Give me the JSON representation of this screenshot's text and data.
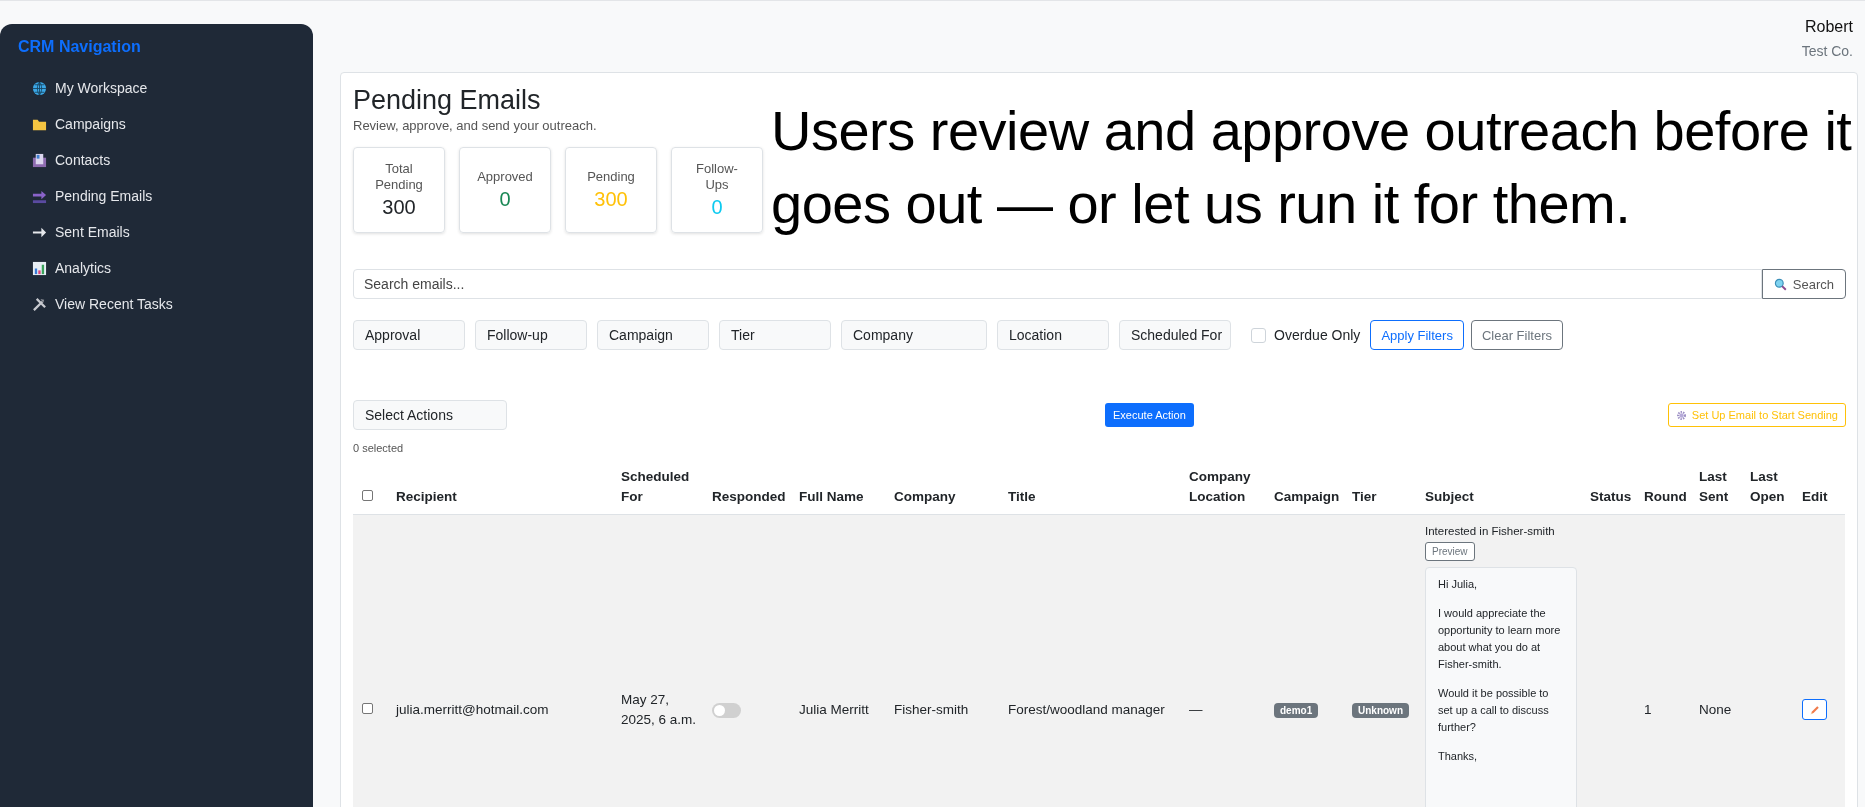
{
  "sidebar": {
    "title": "CRM Navigation",
    "items": [
      {
        "label": "My Workspace",
        "kind": "globe"
      },
      {
        "label": "Campaigns",
        "kind": "folder"
      },
      {
        "label": "Contacts",
        "kind": "contacts"
      },
      {
        "label": "Pending Emails",
        "kind": "soon"
      },
      {
        "label": "Sent Emails",
        "kind": "arrow"
      },
      {
        "label": "Analytics",
        "kind": "chart"
      },
      {
        "label": "View Recent Tasks",
        "kind": "tools"
      }
    ]
  },
  "user": {
    "name": "Robert",
    "company": "Test Co."
  },
  "page": {
    "title": "Pending Emails",
    "subtitle": "Review, approve, and send your outreach."
  },
  "stats": [
    {
      "label": "Total Pending",
      "value": "300",
      "color": "#212529"
    },
    {
      "label": "Approved",
      "value": "0",
      "color": "#198754"
    },
    {
      "label": "Pending",
      "value": "300",
      "color": "#ffc107"
    },
    {
      "label": "Follow-Ups",
      "value": "0",
      "color": "#0dcaf0"
    }
  ],
  "annotation": "Users review and approve outreach before it goes out — or let us run it for them.",
  "search": {
    "placeholder": "Search emails...",
    "button": "Search"
  },
  "filters": [
    "Approval",
    "Follow-up",
    "Campaign",
    "Tier",
    "Company",
    "Location",
    "Scheduled For"
  ],
  "overdue_only": {
    "label": "Overdue Only",
    "checked": false
  },
  "filter_buttons": [
    {
      "label": "Apply Filters",
      "kind": "primary"
    },
    {
      "label": "Clear Filters",
      "kind": "secondary"
    }
  ],
  "actions": {
    "select": "Select Actions",
    "execute": "Execute Action",
    "setup": "Set Up Email to Start Sending",
    "selected_count": "0 selected"
  },
  "table": {
    "select_all_checked": false,
    "columns": [
      "Recipient",
      "Scheduled For",
      "Responded",
      "Full Name",
      "Company",
      "Title",
      "Company Location",
      "Campaign",
      "Tier",
      "Subject",
      "Status",
      "Round",
      "Last Sent",
      "Last Open",
      "Edit"
    ],
    "rows": [
      {
        "checked": false,
        "recipient": "julia.merritt@hotmail.com",
        "scheduled_for": "May 27, 2025, 6 a.m.",
        "responded": false,
        "full_name": "Julia Merritt",
        "company": "Fisher-smith",
        "title": "Forest/woodland manager",
        "company_location": "—",
        "campaign": "demo1",
        "tier": "Unknown",
        "subject": "Interested in Fisher-smith",
        "preview_button": "Preview",
        "body": [
          "Hi Julia,",
          "I would appreciate the opportunity to learn more about what you do at Fisher-smith.",
          "Would it be possible to set up a call to discuss further?",
          "Thanks,"
        ],
        "round": "1",
        "last_sent": "None"
      }
    ]
  }
}
